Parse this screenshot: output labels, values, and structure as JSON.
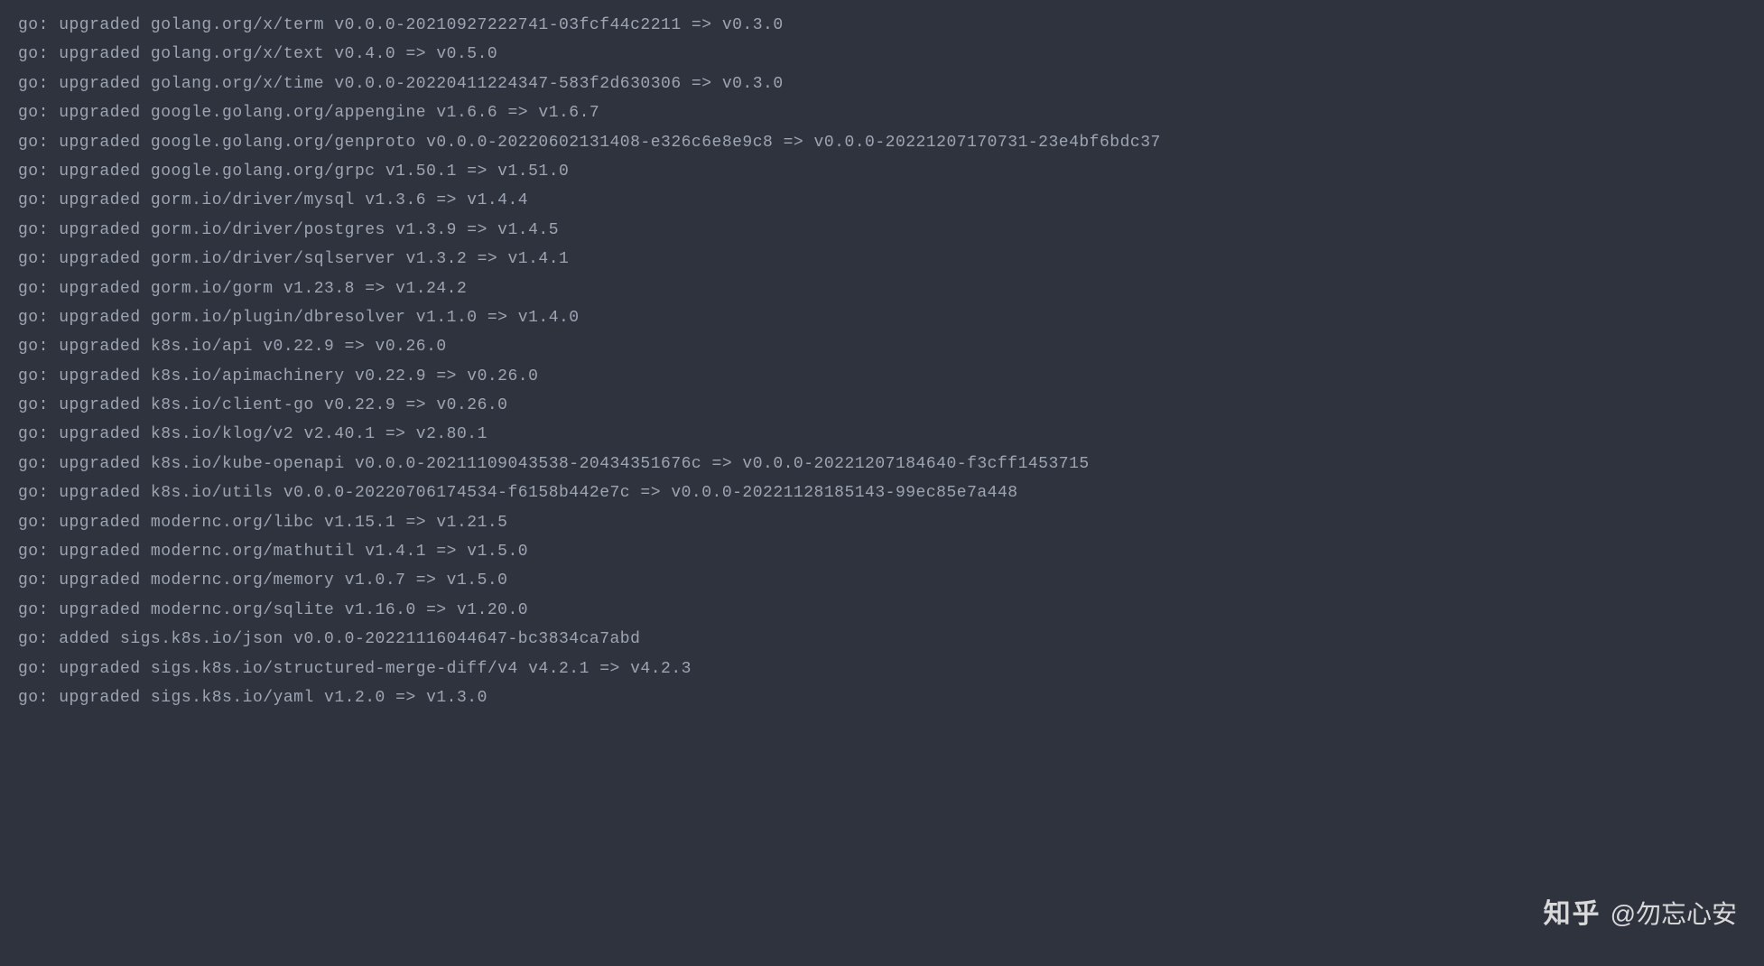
{
  "lines": [
    "go: upgraded golang.org/x/term v0.0.0-20210927222741-03fcf44c2211 => v0.3.0",
    "go: upgraded golang.org/x/text v0.4.0 => v0.5.0",
    "go: upgraded golang.org/x/time v0.0.0-20220411224347-583f2d630306 => v0.3.0",
    "go: upgraded google.golang.org/appengine v1.6.6 => v1.6.7",
    "go: upgraded google.golang.org/genproto v0.0.0-20220602131408-e326c6e8e9c8 => v0.0.0-20221207170731-23e4bf6bdc37",
    "go: upgraded google.golang.org/grpc v1.50.1 => v1.51.0",
    "go: upgraded gorm.io/driver/mysql v1.3.6 => v1.4.4",
    "go: upgraded gorm.io/driver/postgres v1.3.9 => v1.4.5",
    "go: upgraded gorm.io/driver/sqlserver v1.3.2 => v1.4.1",
    "go: upgraded gorm.io/gorm v1.23.8 => v1.24.2",
    "go: upgraded gorm.io/plugin/dbresolver v1.1.0 => v1.4.0",
    "go: upgraded k8s.io/api v0.22.9 => v0.26.0",
    "go: upgraded k8s.io/apimachinery v0.22.9 => v0.26.0",
    "go: upgraded k8s.io/client-go v0.22.9 => v0.26.0",
    "go: upgraded k8s.io/klog/v2 v2.40.1 => v2.80.1",
    "go: upgraded k8s.io/kube-openapi v0.0.0-20211109043538-20434351676c => v0.0.0-20221207184640-f3cff1453715",
    "go: upgraded k8s.io/utils v0.0.0-20220706174534-f6158b442e7c => v0.0.0-20221128185143-99ec85e7a448",
    "go: upgraded modernc.org/libc v1.15.1 => v1.21.5",
    "go: upgraded modernc.org/mathutil v1.4.1 => v1.5.0",
    "go: upgraded modernc.org/memory v1.0.7 => v1.5.0",
    "go: upgraded modernc.org/sqlite v1.16.0 => v1.20.0",
    "go: added sigs.k8s.io/json v0.0.0-20221116044647-bc3834ca7abd",
    "go: upgraded sigs.k8s.io/structured-merge-diff/v4 v4.2.1 => v4.2.3",
    "go: upgraded sigs.k8s.io/yaml v1.2.0 => v1.3.0"
  ],
  "watermark": {
    "logo": "知乎",
    "text": "@勿忘心安"
  }
}
